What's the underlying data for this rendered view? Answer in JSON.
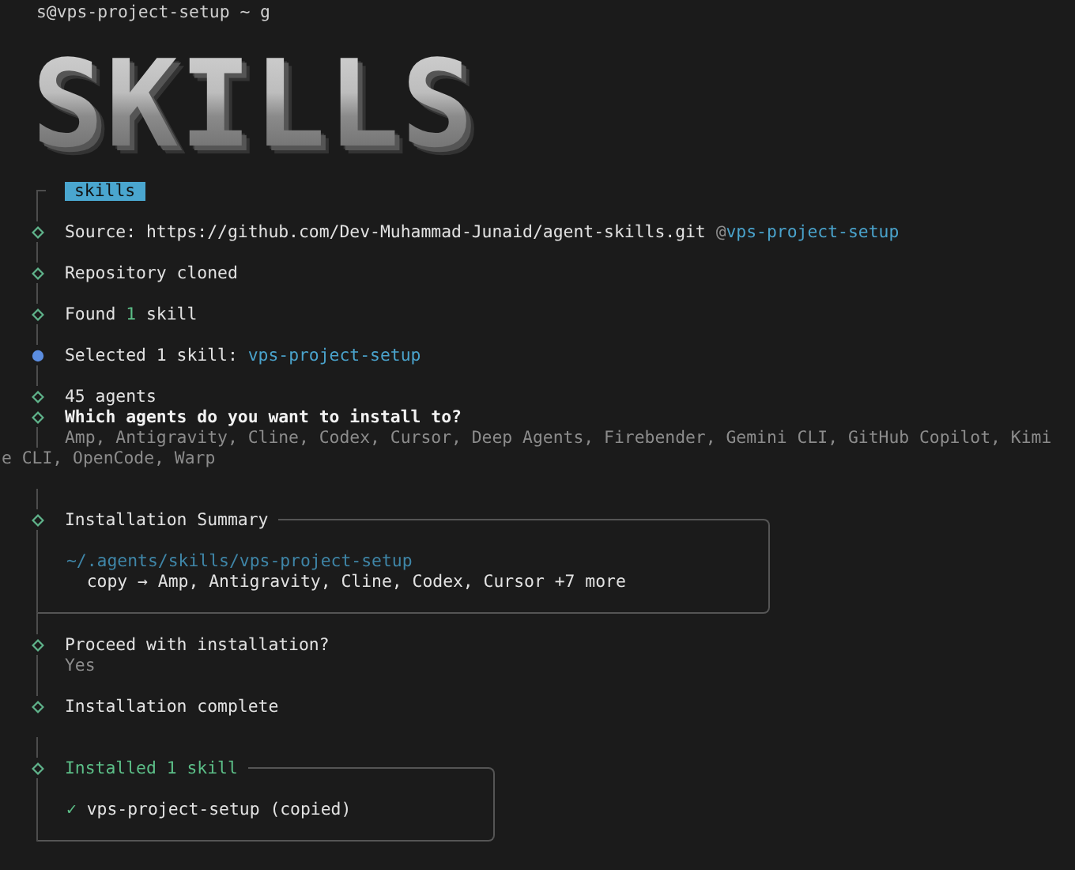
{
  "prompt": "s@vps-project-setup ~ g",
  "logo": "SKILLS",
  "lines": [
    {
      "kind": "badge",
      "marker": {
        "kind": "corner"
      },
      "badge": "skills"
    },
    {
      "kind": "gap",
      "marker": {
        "kind": "bar"
      }
    },
    {
      "kind": "text",
      "marker": {
        "kind": "done"
      },
      "segments": [
        {
          "text": "Source: https://github.com/Dev-Muhammad-Junaid/agent-skills.git ",
          "kind": "plain"
        },
        {
          "text": "@",
          "kind": "muted"
        },
        {
          "text": "vps-project-setup",
          "kind": "link"
        }
      ]
    },
    {
      "kind": "gap",
      "marker": {
        "kind": "bar"
      }
    },
    {
      "kind": "text",
      "marker": {
        "kind": "done"
      },
      "segments": [
        {
          "text": "Repository cloned",
          "kind": "plain"
        }
      ]
    },
    {
      "kind": "gap",
      "marker": {
        "kind": "bar"
      }
    },
    {
      "kind": "text",
      "marker": {
        "kind": "done"
      },
      "segments": [
        {
          "text": "Found ",
          "kind": "plain"
        },
        {
          "text": "1",
          "kind": "success"
        },
        {
          "text": " skill",
          "kind": "plain"
        }
      ]
    },
    {
      "kind": "gap",
      "marker": {
        "kind": "bar"
      }
    },
    {
      "kind": "text",
      "marker": {
        "kind": "active"
      },
      "segments": [
        {
          "text": "Selected 1 skill: ",
          "kind": "plain"
        },
        {
          "text": "vps-project-setup",
          "kind": "link"
        }
      ]
    },
    {
      "kind": "gap",
      "marker": {
        "kind": "bar"
      }
    },
    {
      "kind": "text",
      "marker": {
        "kind": "done"
      },
      "segments": [
        {
          "text": "45 agents",
          "kind": "plain"
        }
      ]
    },
    {
      "kind": "text",
      "marker": {
        "kind": "done"
      },
      "segments": [
        {
          "text": "Which agents do you want to install to?",
          "kind": "strong"
        }
      ]
    },
    {
      "kind": "text",
      "marker": {
        "kind": "bar"
      },
      "segments": [
        {
          "text": "Amp, Antigravity, Cline, Codex, Cursor, Deep Agents, Firebender, Gemini CLI, GitHub Copilot, Kimi",
          "kind": "muted"
        }
      ]
    },
    {
      "kind": "wrap",
      "segments": [
        {
          "text": "e CLI, OpenCode, Warp",
          "kind": "muted"
        }
      ]
    },
    {
      "kind": "gap"
    },
    {
      "kind": "gap",
      "marker": {
        "kind": "bar"
      }
    },
    {
      "kind": "box",
      "marker": {
        "kind": "done"
      },
      "title": {
        "text": "Installation Summary",
        "kind": "plain"
      },
      "body": [
        {
          "indented": false,
          "segments": [
            {
              "text": "~/.agents/skills/vps-project-setup",
              "kind": "path"
            }
          ]
        },
        {
          "indented": true,
          "segments": [
            {
              "text": "copy → Amp, Antigravity, Cline, Codex, Cursor +7 more",
              "kind": "plain"
            }
          ]
        }
      ]
    },
    {
      "kind": "gap",
      "marker": {
        "kind": "bar"
      }
    },
    {
      "kind": "text",
      "marker": {
        "kind": "done"
      },
      "segments": [
        {
          "text": "Proceed with installation?",
          "kind": "plain"
        }
      ]
    },
    {
      "kind": "text",
      "marker": {
        "kind": "bar"
      },
      "segments": [
        {
          "text": "Yes",
          "kind": "muted"
        }
      ]
    },
    {
      "kind": "gap",
      "marker": {
        "kind": "bar"
      }
    },
    {
      "kind": "text",
      "marker": {
        "kind": "done"
      },
      "segments": [
        {
          "text": "Installation complete",
          "kind": "plain"
        }
      ]
    },
    {
      "kind": "gap"
    },
    {
      "kind": "gap",
      "marker": {
        "kind": "bar"
      }
    },
    {
      "kind": "box",
      "marker": {
        "kind": "done"
      },
      "title": {
        "text": "Installed 1 skill",
        "kind": "success"
      },
      "body": [
        {
          "indented": false,
          "segments": [
            {
              "text": "✓",
              "kind": "success"
            },
            {
              "text": " vps-project-setup (copied)",
              "kind": "plain"
            }
          ]
        }
      ]
    }
  ]
}
